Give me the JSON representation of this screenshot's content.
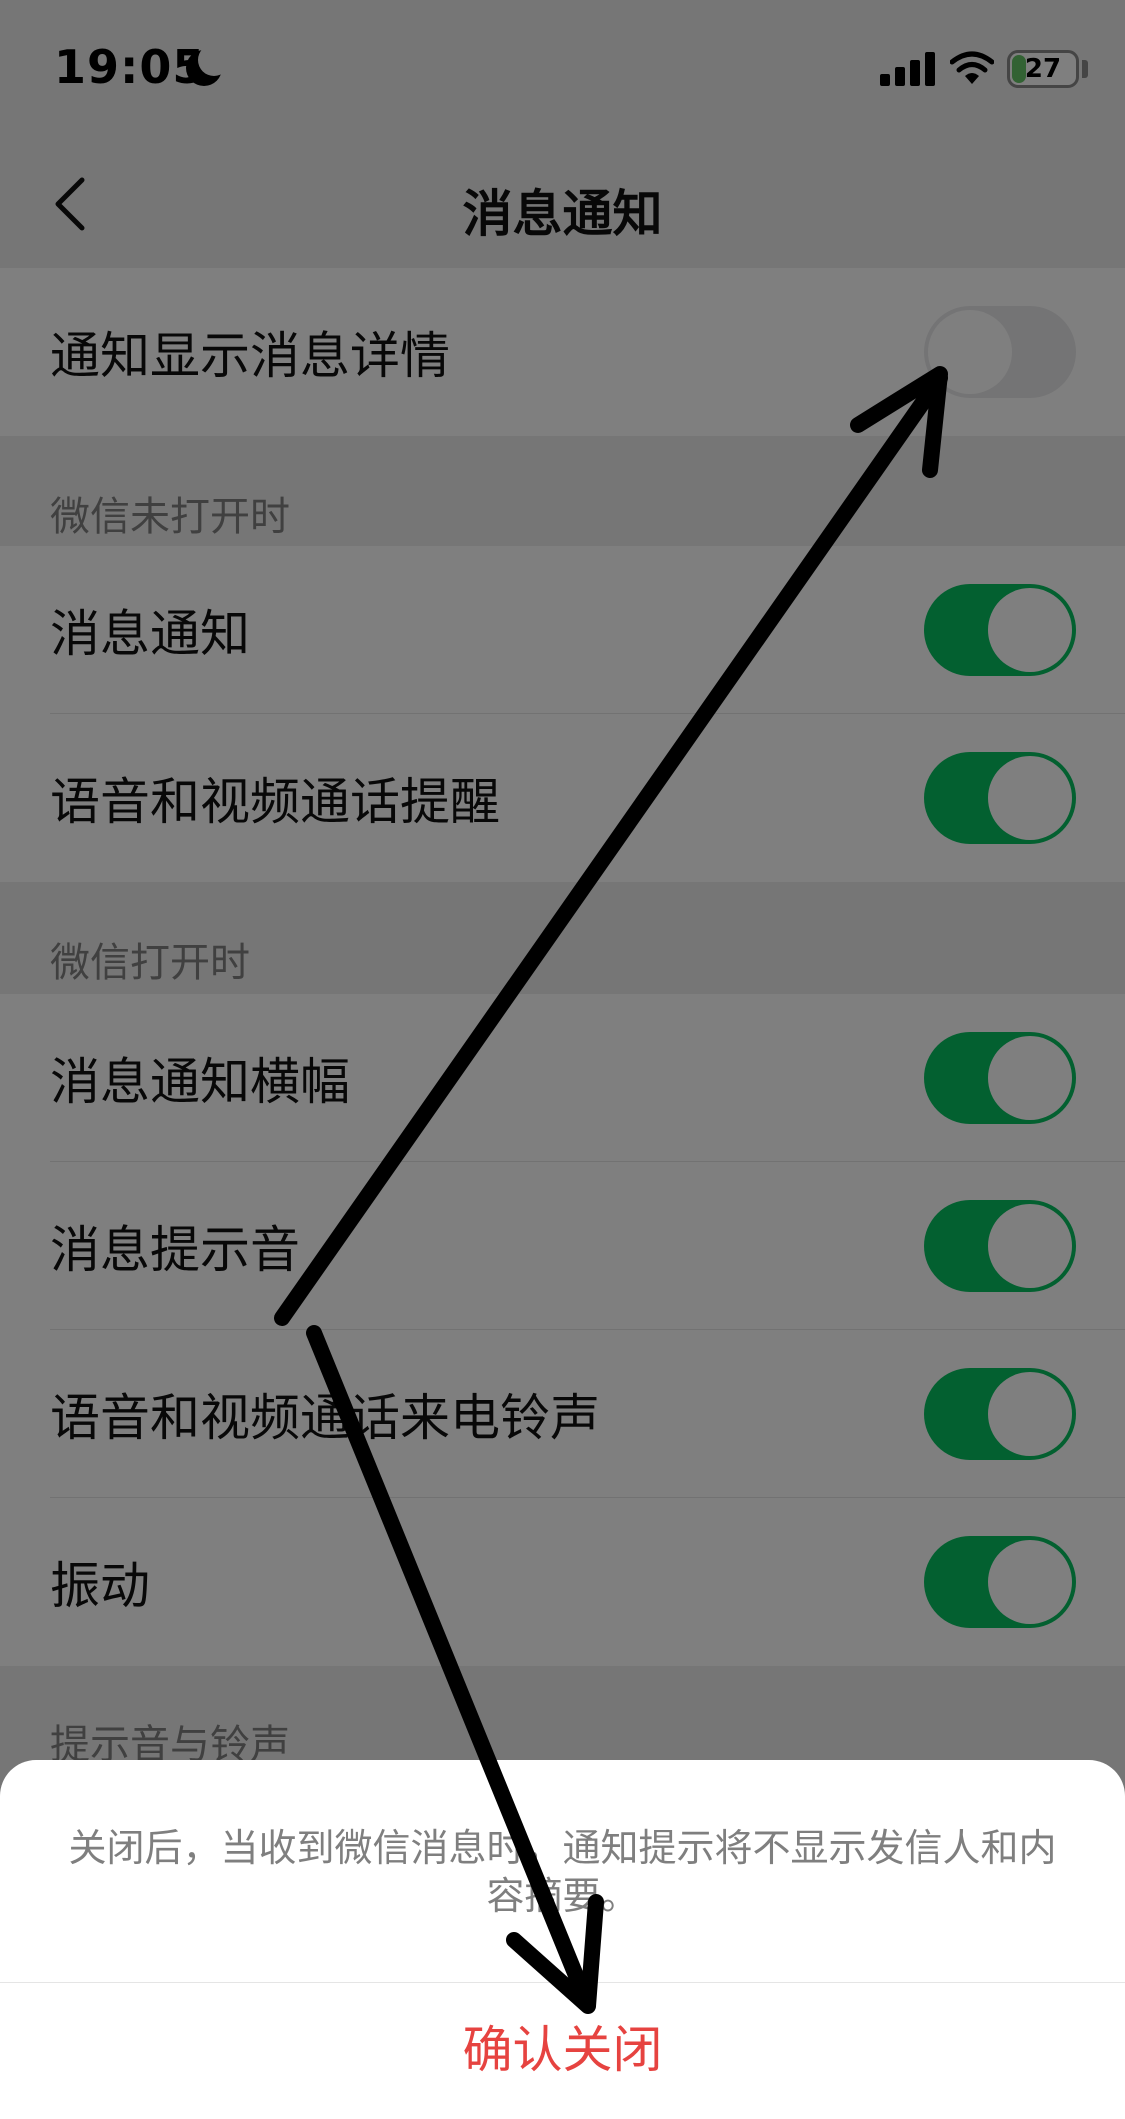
{
  "status_bar": {
    "time": "19:05",
    "battery_level": "27",
    "battery_percent": 27,
    "icons": [
      "moon-icon",
      "signal-icon",
      "wifi-icon",
      "battery-icon"
    ]
  },
  "nav": {
    "title": "消息通知",
    "back_icon": "chevron-left-icon"
  },
  "settings": {
    "top_row": {
      "label": "通知显示消息详情",
      "enabled": false
    },
    "section_closed": {
      "header": "微信未打开时",
      "rows": [
        {
          "label": "消息通知",
          "enabled": true
        },
        {
          "label": "语音和视频通话提醒",
          "enabled": true
        }
      ]
    },
    "section_open": {
      "header": "微信打开时",
      "rows": [
        {
          "label": "消息通知横幅",
          "enabled": true
        },
        {
          "label": "消息提示音",
          "enabled": true
        },
        {
          "label": "语音和视频通话来电铃声",
          "enabled": true
        },
        {
          "label": "振动",
          "enabled": true
        }
      ]
    },
    "section_sounds": {
      "header": "提示音与铃声"
    }
  },
  "sheet": {
    "message": "关闭后，当收到微信消息时，通知提示将不显示发信人和内容摘要。",
    "confirm_label": "确认关闭"
  },
  "colors": {
    "switch_on": "#07c160",
    "switch_off": "#e9e9ea",
    "destructive": "#e64340",
    "overlay": "rgba(0,0,0,0.5)",
    "annotation": "#000000"
  }
}
